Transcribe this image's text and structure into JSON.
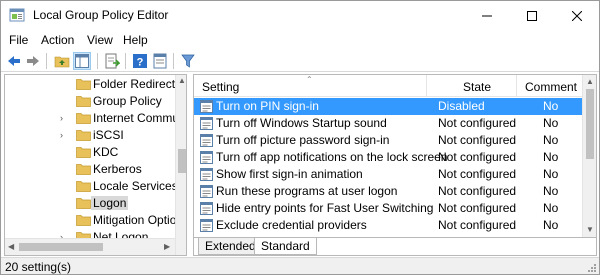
{
  "window": {
    "title": "Local Group Policy Editor",
    "minimize": "—",
    "maximize": "☐",
    "close": "✕"
  },
  "menu": [
    "File",
    "Action",
    "View",
    "Help"
  ],
  "toolbar": {
    "icons": [
      "back-arrow-icon",
      "forward-arrow-icon",
      "up-folder-icon",
      "show-hide-tree-icon",
      "export-list-icon",
      "help-icon",
      "properties-icon",
      "filter-icon"
    ]
  },
  "tree": {
    "items": [
      {
        "label": "Folder Redirection",
        "expandable": false,
        "selected": false
      },
      {
        "label": "Group Policy",
        "expandable": false,
        "selected": false
      },
      {
        "label": "Internet Communication",
        "expandable": true,
        "selected": false
      },
      {
        "label": "iSCSI",
        "expandable": true,
        "selected": false
      },
      {
        "label": "KDC",
        "expandable": false,
        "selected": false
      },
      {
        "label": "Kerberos",
        "expandable": false,
        "selected": false
      },
      {
        "label": "Locale Services",
        "expandable": false,
        "selected": false
      },
      {
        "label": "Logon",
        "expandable": false,
        "selected": true
      },
      {
        "label": "Mitigation Options",
        "expandable": false,
        "selected": false
      },
      {
        "label": "Net Logon",
        "expandable": true,
        "selected": false
      }
    ]
  },
  "list": {
    "columns": {
      "setting": "Setting",
      "state": "State",
      "comment": "Comment"
    },
    "rows": [
      {
        "setting": "Turn on PIN sign-in",
        "state": "Disabled",
        "comment": "No",
        "selected": true
      },
      {
        "setting": "Turn off Windows Startup sound",
        "state": "Not configured",
        "comment": "No",
        "selected": false
      },
      {
        "setting": "Turn off picture password sign-in",
        "state": "Not configured",
        "comment": "No",
        "selected": false
      },
      {
        "setting": "Turn off app notifications on the lock screen",
        "state": "Not configured",
        "comment": "No",
        "selected": false
      },
      {
        "setting": "Show first sign-in animation",
        "state": "Not configured",
        "comment": "No",
        "selected": false
      },
      {
        "setting": "Run these programs at user logon",
        "state": "Not configured",
        "comment": "No",
        "selected": false
      },
      {
        "setting": "Hide entry points for Fast User Switching",
        "state": "Not configured",
        "comment": "No",
        "selected": false
      },
      {
        "setting": "Exclude credential providers",
        "state": "Not configured",
        "comment": "No",
        "selected": false
      }
    ],
    "tabs": [
      {
        "label": "Extended",
        "active": false
      },
      {
        "label": "Standard",
        "active": true
      }
    ]
  },
  "status": {
    "text": "20 setting(s)"
  },
  "colors": {
    "selection": "#3399ff",
    "tree_selection": "#d9d9d9",
    "folder": "#e8c15a"
  }
}
